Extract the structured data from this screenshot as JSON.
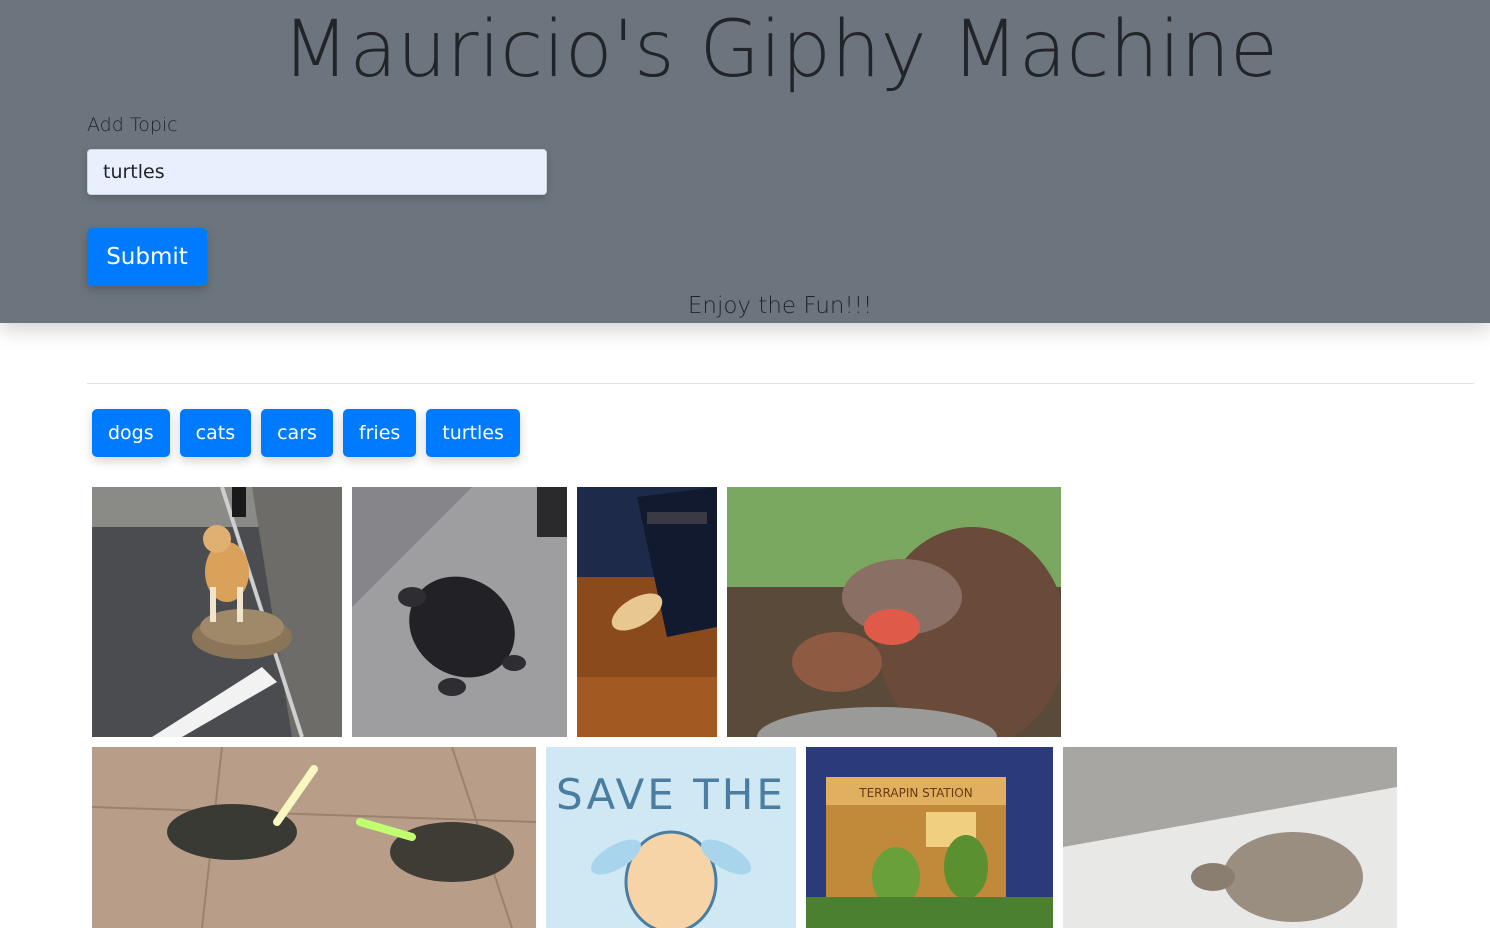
{
  "header": {
    "title": "Mauricio's Giphy Machine",
    "add_topic_label": "Add Topic",
    "topic_input_value": "turtles",
    "submit_label": "Submit",
    "tagline": "Enjoy the Fun!!!"
  },
  "topics": [
    "dogs",
    "cats",
    "cars",
    "fries",
    "turtles"
  ],
  "gifs": [
    {
      "name": "gif-dog-riding-tortoise",
      "icon": "dog-on-tortoise-image"
    },
    {
      "name": "gif-black-turtle",
      "icon": "black-turtle-image"
    },
    {
      "name": "gif-small-turtle-on-floor",
      "icon": "small-turtle-image"
    },
    {
      "name": "gif-tortoise-open-mouth",
      "icon": "tortoise-face-image"
    },
    {
      "name": "gif-turtles-lightsabers",
      "icon": "turtles-lightsabers-image"
    },
    {
      "name": "gif-save-the-turtles",
      "icon": "sea-turtle-illustration",
      "text": "SAVE THE"
    },
    {
      "name": "gif-cartoon-turtles-dancing",
      "icon": "cartoon-turtles-image",
      "text": "TERRAPIN STATION"
    },
    {
      "name": "gif-tortoise-walking",
      "icon": "tortoise-walking-image"
    }
  ],
  "colors": {
    "header_bg": "#6c757d",
    "primary": "#007bff",
    "input_bg": "#e8f0fe"
  }
}
